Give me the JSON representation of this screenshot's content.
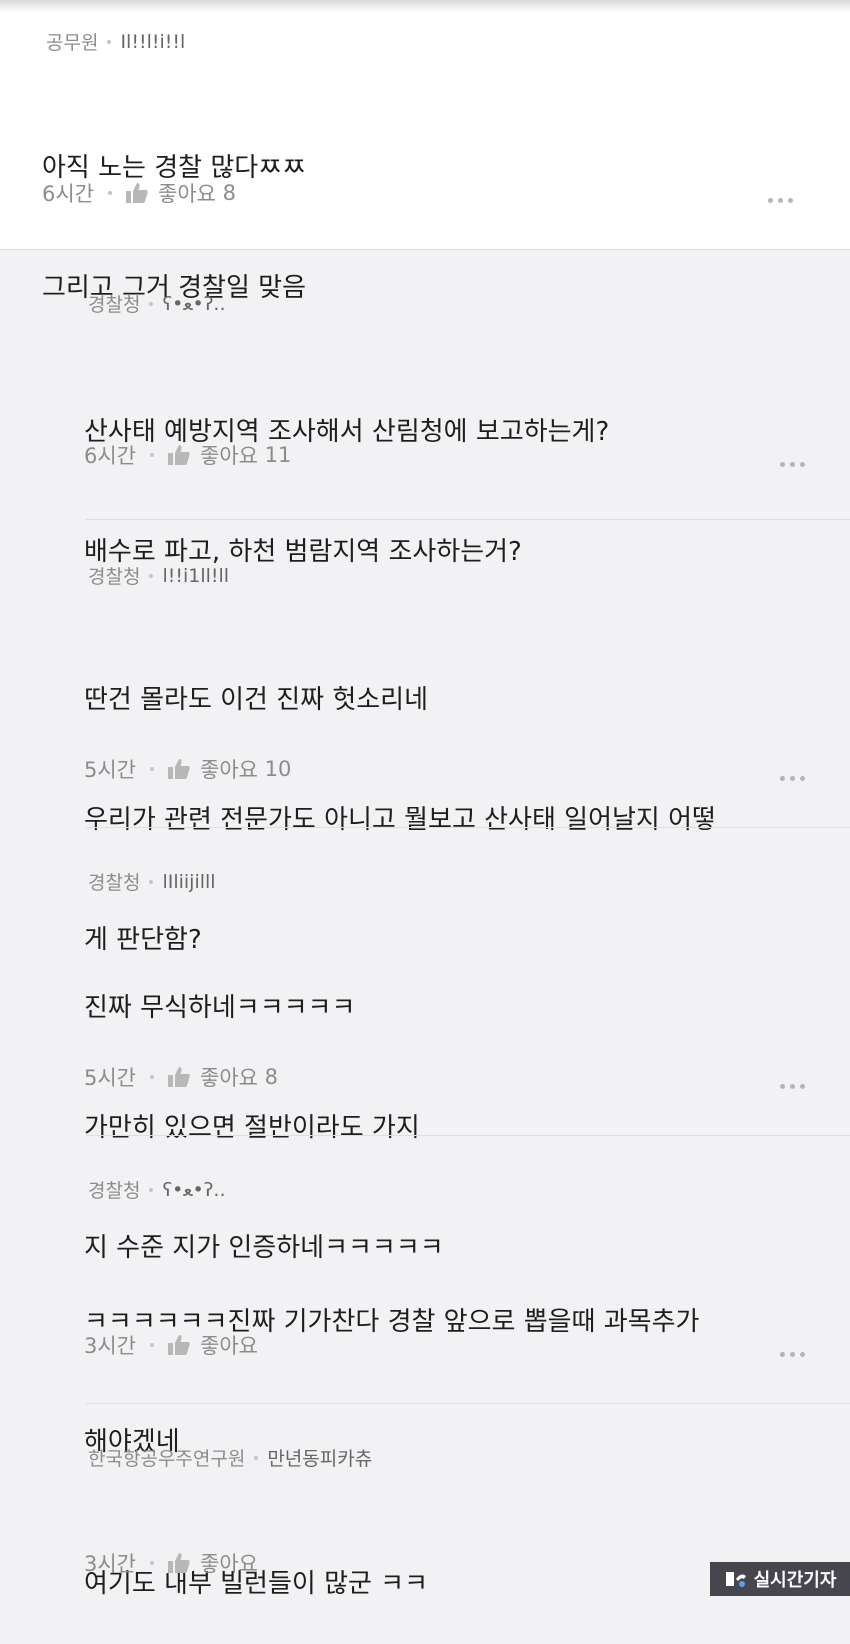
{
  "comments": [
    {
      "org": "공무원",
      "nick": "Il!!l!i!!l",
      "lines": [
        "아직 노는 경찰 많다ㅉㅉ",
        "그리고 그거 경찰일 맞음"
      ],
      "time": "6시간",
      "like_label": "좋아요",
      "like_count": "8"
    },
    {
      "org": "경찰청",
      "nick": "ʕ•ﻌ•ʔ..",
      "lines": [
        "산사태 예방지역 조사해서 산림청에 보고하는게?",
        "배수로 파고, 하천 범람지역 조사하는거?"
      ],
      "time": "6시간",
      "like_label": "좋아요",
      "like_count": "11"
    },
    {
      "org": "경찰청",
      "nick": "l!!i1ll!ll",
      "lines": [
        "딴건 몰라도 이건 진짜 헛소리네",
        "우리가 관련 전문가도 아니고 뭘보고 산사태 일어날지 어떻",
        "게 판단함?"
      ],
      "time": "5시간",
      "like_label": "좋아요",
      "like_count": "10"
    },
    {
      "org": "경찰청",
      "nick": "lIliijilll",
      "lines": [
        "진짜 무식하네ㅋㅋㅋㅋㅋ",
        "가만히 있으면 절반이라도 가지",
        "지 수준 지가 인증하네ㅋㅋㅋㅋㅋ"
      ],
      "time": "5시간",
      "like_label": "좋아요",
      "like_count": "8"
    },
    {
      "org": "경찰청",
      "nick": "ʕ•ﻌ•ʔ..",
      "lines": [
        "ㅋㅋㅋㅋㅋㅋ진짜 기가찬다 경찰 앞으로 뽑을때 과목추가",
        "해야겠네"
      ],
      "time": "3시간",
      "like_label": "좋아요",
      "like_count": ""
    },
    {
      "org": "한국항공우주연구원",
      "nick": "만년동피카츄",
      "lines": [
        "여기도 내부 빌런들이 많군 ㅋㅋ"
      ],
      "time": "3시간",
      "like_label": "좋아요",
      "like_count": ""
    }
  ],
  "watermark": {
    "text": "실시간기자"
  },
  "colors": {
    "reply_bg": "#f2f2f4",
    "main_bg": "#ffffff",
    "meta_text": "#8c8c8c",
    "body_text": "#1e1e1e"
  }
}
